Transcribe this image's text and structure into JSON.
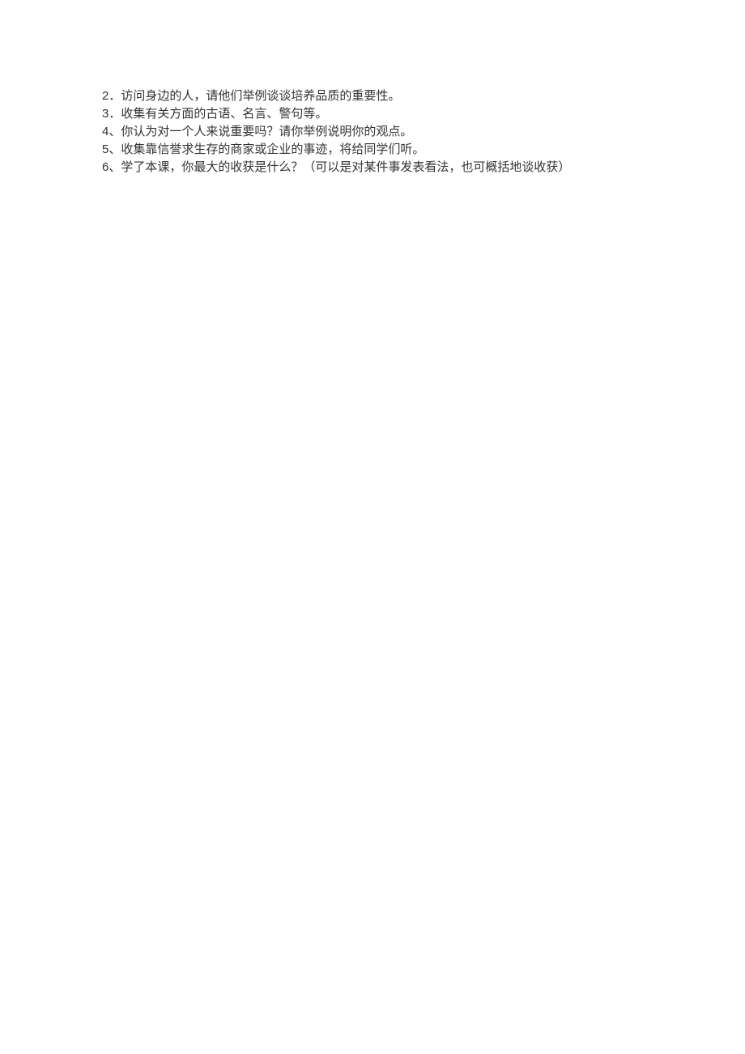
{
  "lines": [
    {
      "num": "2．",
      "text": "访问身边的人，请他们举例谈谈培养品质的重要性。"
    },
    {
      "num": "3．",
      "text": "收集有关方面的古语、名言、警句等。"
    },
    {
      "num": "4、",
      "text": "你认为对一个人来说重要吗？请你举例说明你的观点。"
    },
    {
      "num": "5、",
      "text": "收集靠信誉求生存的商家或企业的事迹，将给同学们听。"
    },
    {
      "num": "6、",
      "text": "学了本课，你最大的收获是什么？（可以是对某件事发表看法，也可概括地谈收获）"
    }
  ]
}
